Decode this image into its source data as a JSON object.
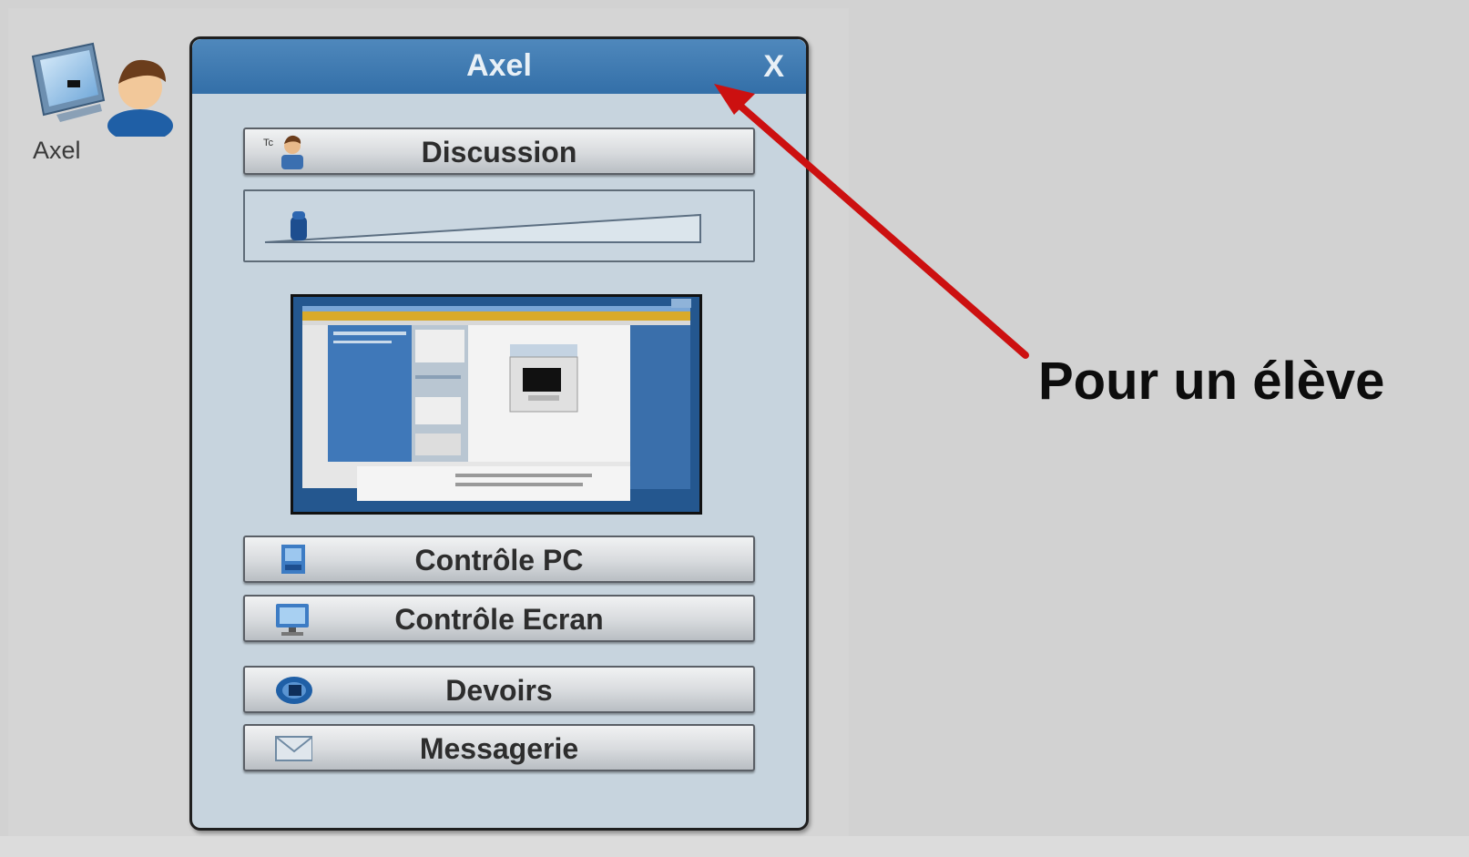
{
  "desktop_icon": {
    "label": "Axel",
    "icon": "student-computer-icon"
  },
  "popup": {
    "title": "Axel",
    "close_label": "X",
    "buttons": [
      {
        "id": "discussion",
        "label": "Discussion",
        "icon": "chat-person-icon"
      },
      {
        "id": "controle-pc",
        "label": "Contrôle PC",
        "icon": "pc-control-icon"
      },
      {
        "id": "controle-ecran",
        "label": "Contrôle Ecran",
        "icon": "monitor-icon"
      },
      {
        "id": "devoirs",
        "label": "Devoirs",
        "icon": "homework-icon"
      },
      {
        "id": "messagerie",
        "label": "Messagerie",
        "icon": "envelope-icon"
      }
    ],
    "volume": {
      "icon": "microphone-icon",
      "level": 0.05
    },
    "screen_preview": {
      "icon": "screen-thumbnail"
    }
  },
  "annotation": {
    "label": "Pour un élève",
    "arrow_color": "#cc1010"
  }
}
